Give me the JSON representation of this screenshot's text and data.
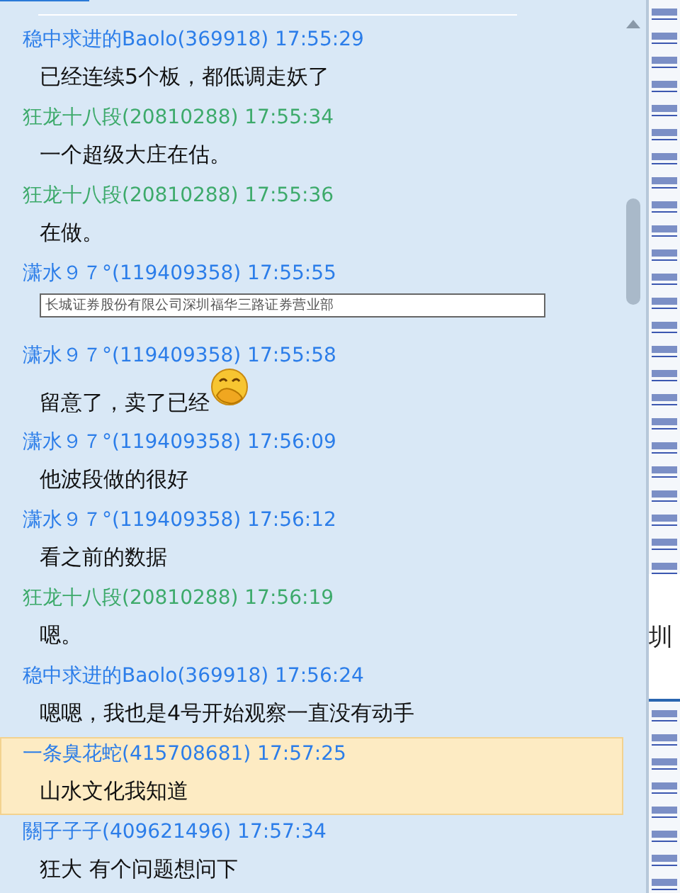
{
  "chat": {
    "messages": [
      {
        "header": "稳中求进的Baolo(369918) 17:55:29",
        "color": "#2b7de9",
        "highlighted": false,
        "body": {
          "kind": "text",
          "text": "已经连续5个板，都低调走妖了"
        }
      },
      {
        "header": "狂龙十八段(20810288) 17:55:34",
        "color": "#3daa6b",
        "highlighted": false,
        "body": {
          "kind": "text",
          "text": "一个超级大庄在估。"
        }
      },
      {
        "header": "狂龙十八段(20810288) 17:55:36",
        "color": "#3daa6b",
        "highlighted": false,
        "body": {
          "kind": "text",
          "text": "在做。"
        }
      },
      {
        "header": "潇水９７°(119409358) 17:55:55",
        "color": "#2b7de9",
        "highlighted": false,
        "body": {
          "kind": "image",
          "text": "长城证券股份有限公司深圳福华三路证券营业部"
        }
      },
      {
        "header": "潇水９７°(119409358) 17:55:58",
        "color": "#2b7de9",
        "highlighted": false,
        "body": {
          "kind": "emoji",
          "text": "留意了，卖了已经"
        }
      },
      {
        "header": "潇水９７°(119409358) 17:56:09",
        "color": "#2b7de9",
        "highlighted": false,
        "body": {
          "kind": "text",
          "text": "他波段做的很好"
        }
      },
      {
        "header": "潇水９７°(119409358) 17:56:12",
        "color": "#2b7de9",
        "highlighted": false,
        "body": {
          "kind": "text",
          "text": "看之前的数据"
        }
      },
      {
        "header": "狂龙十八段(20810288) 17:56:19",
        "color": "#3daa6b",
        "highlighted": false,
        "body": {
          "kind": "text",
          "text": "嗯。"
        }
      },
      {
        "header": "稳中求进的Baolo(369918) 17:56:24",
        "color": "#2b7de9",
        "highlighted": false,
        "body": {
          "kind": "text",
          "text": "嗯嗯，我也是4号开始观察一直没有动手"
        }
      },
      {
        "header": "一条臭花蛇(415708681) 17:57:25",
        "color": "#2b7de9",
        "highlighted": true,
        "body": {
          "kind": "text",
          "text": "山水文化我知道"
        }
      },
      {
        "header": "關子子子(409621496) 17:57:34",
        "color": "#2b7de9",
        "highlighted": false,
        "body": {
          "kind": "text",
          "text": "狂大 有个问题想问下"
        }
      }
    ]
  },
  "side_window": {
    "partial_text": "圳"
  }
}
